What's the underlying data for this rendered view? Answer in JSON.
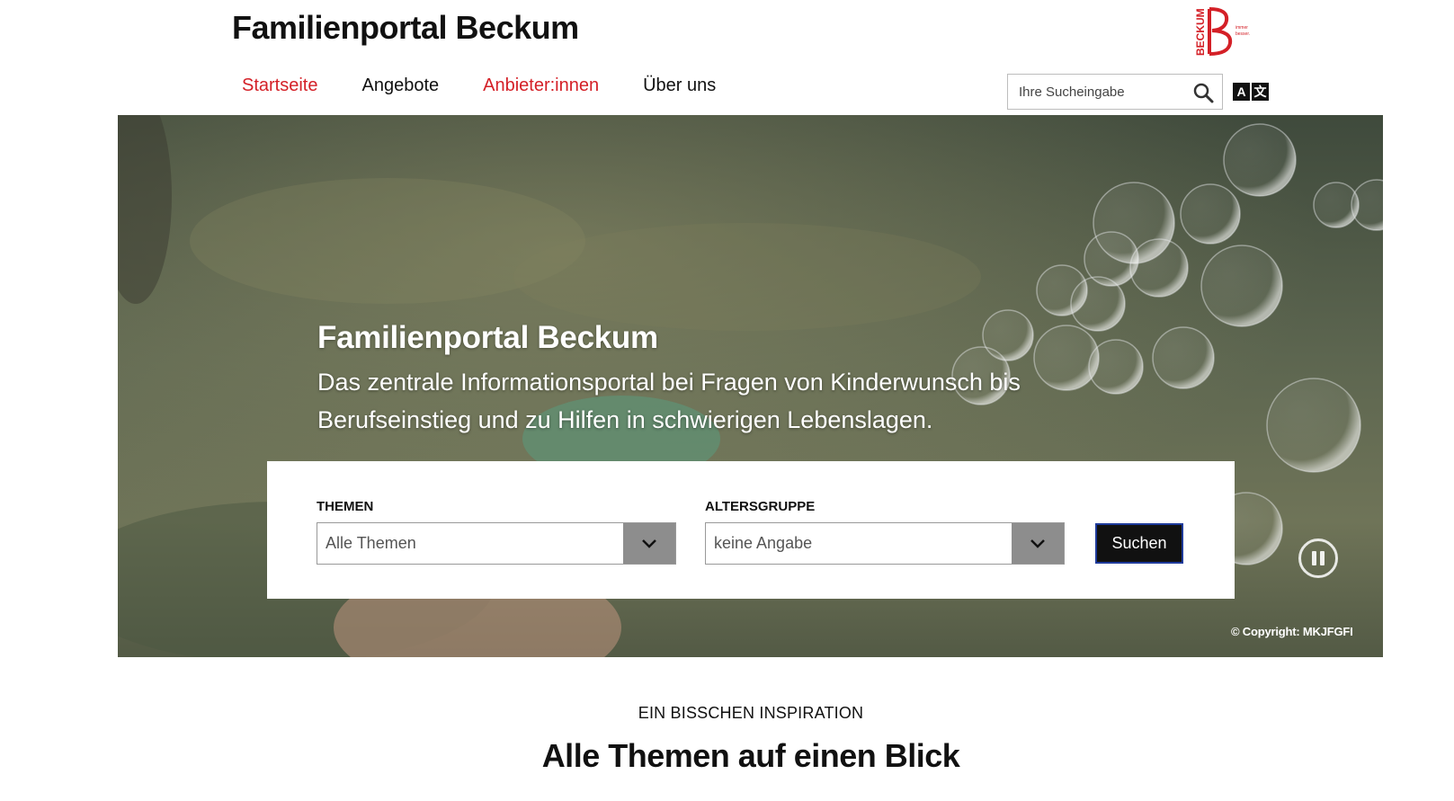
{
  "header": {
    "site_title": "Familienportal Beckum",
    "logo_text": "BECKUM",
    "logo_tagline": "immer besser."
  },
  "nav": {
    "items": [
      {
        "label": "Startseite"
      },
      {
        "label": "Angebote"
      },
      {
        "label": "Anbieter:innen"
      },
      {
        "label": "Über uns"
      }
    ]
  },
  "search": {
    "placeholder": "Ihre Sucheingabe",
    "icon": "search-icon"
  },
  "language": {
    "icon": "translate-icon",
    "glyph_a": "A",
    "glyph_b": "文"
  },
  "hero": {
    "title": "Familienportal Beckum",
    "subtitle": "Das zentrale Informationsportal bei Fragen von Kinderwunsch bis Berufseinstieg und zu Hilfen in schwierigen Lebenslagen.",
    "copyright": "© Copyright: MKJFGFI"
  },
  "filter": {
    "themen_label": "THEMEN",
    "themen_value": "Alle Themen",
    "alter_label": "ALTERSGRUPPE",
    "alter_value": "keine Angabe",
    "submit_label": "Suchen"
  },
  "section": {
    "kicker": "EIN BISSCHEN INSPIRATION",
    "title": "Alle Themen auf einen Blick"
  },
  "colors": {
    "accent": "#d42027",
    "button_bg": "#111111",
    "button_border": "#1e3a9a",
    "select_arrow_bg": "#8d8d8d"
  }
}
